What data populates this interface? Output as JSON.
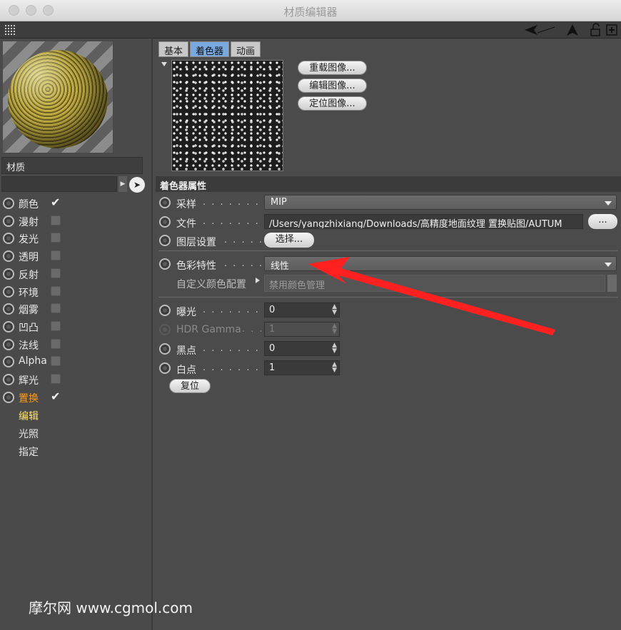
{
  "window": {
    "title": "材质编辑器"
  },
  "toolbar": {
    "icons": [
      "grip-icon",
      "back-arrow-icon",
      "navigate-arrow-icon",
      "lock-icon",
      "new-window-icon"
    ]
  },
  "material": {
    "name": "材质"
  },
  "channels": [
    {
      "label": "颜色",
      "checked": true
    },
    {
      "label": "漫射",
      "checked": false
    },
    {
      "label": "发光",
      "checked": false
    },
    {
      "label": "透明",
      "checked": false
    },
    {
      "label": "反射",
      "checked": false
    },
    {
      "label": "环境",
      "checked": false
    },
    {
      "label": "烟雾",
      "checked": false
    },
    {
      "label": "凹凸",
      "checked": false
    },
    {
      "label": "法线",
      "checked": false
    },
    {
      "label": "Alpha",
      "checked": false
    },
    {
      "label": "辉光",
      "checked": false
    },
    {
      "label": "置换",
      "checked": true,
      "active": true
    }
  ],
  "subitems": [
    {
      "label": "编辑",
      "highlight": true
    },
    {
      "label": "光照"
    },
    {
      "label": "指定"
    }
  ],
  "tabs": [
    {
      "label": "基本"
    },
    {
      "label": "着色器",
      "selected": true
    },
    {
      "label": "动画"
    }
  ],
  "image_buttons": {
    "reload": "重载图像...",
    "edit": "编辑图像...",
    "locate": "定位图像..."
  },
  "section_title": "着色器属性",
  "fields": {
    "sampling": {
      "label": "采样",
      "value": "MIP"
    },
    "file": {
      "label": "文件",
      "value": "/Users/yangzhixiang/Downloads/高精度地面纹理 置换贴图/AUTUM",
      "more": "..."
    },
    "layer": {
      "label": "图层设置",
      "button": "选择..."
    },
    "color_profile": {
      "label": "色彩特性",
      "value": "线性"
    },
    "custom_profile": {
      "label": "自定义颜色配置",
      "value": "禁用颜色管理"
    },
    "exposure": {
      "label": "曝光",
      "value": "0"
    },
    "hdr_gamma": {
      "label": "HDR Gamma",
      "value": "1"
    },
    "black_point": {
      "label": "黑点",
      "value": "0"
    },
    "white_point": {
      "label": "白点",
      "value": "1"
    }
  },
  "reset_button": "复位",
  "watermark": "摩尔网 www.cgmol.com",
  "colors": {
    "accent_tab": "#79a9e0",
    "active_channel": "#ff9a1c",
    "annotation_arrow": "#ff2020"
  }
}
